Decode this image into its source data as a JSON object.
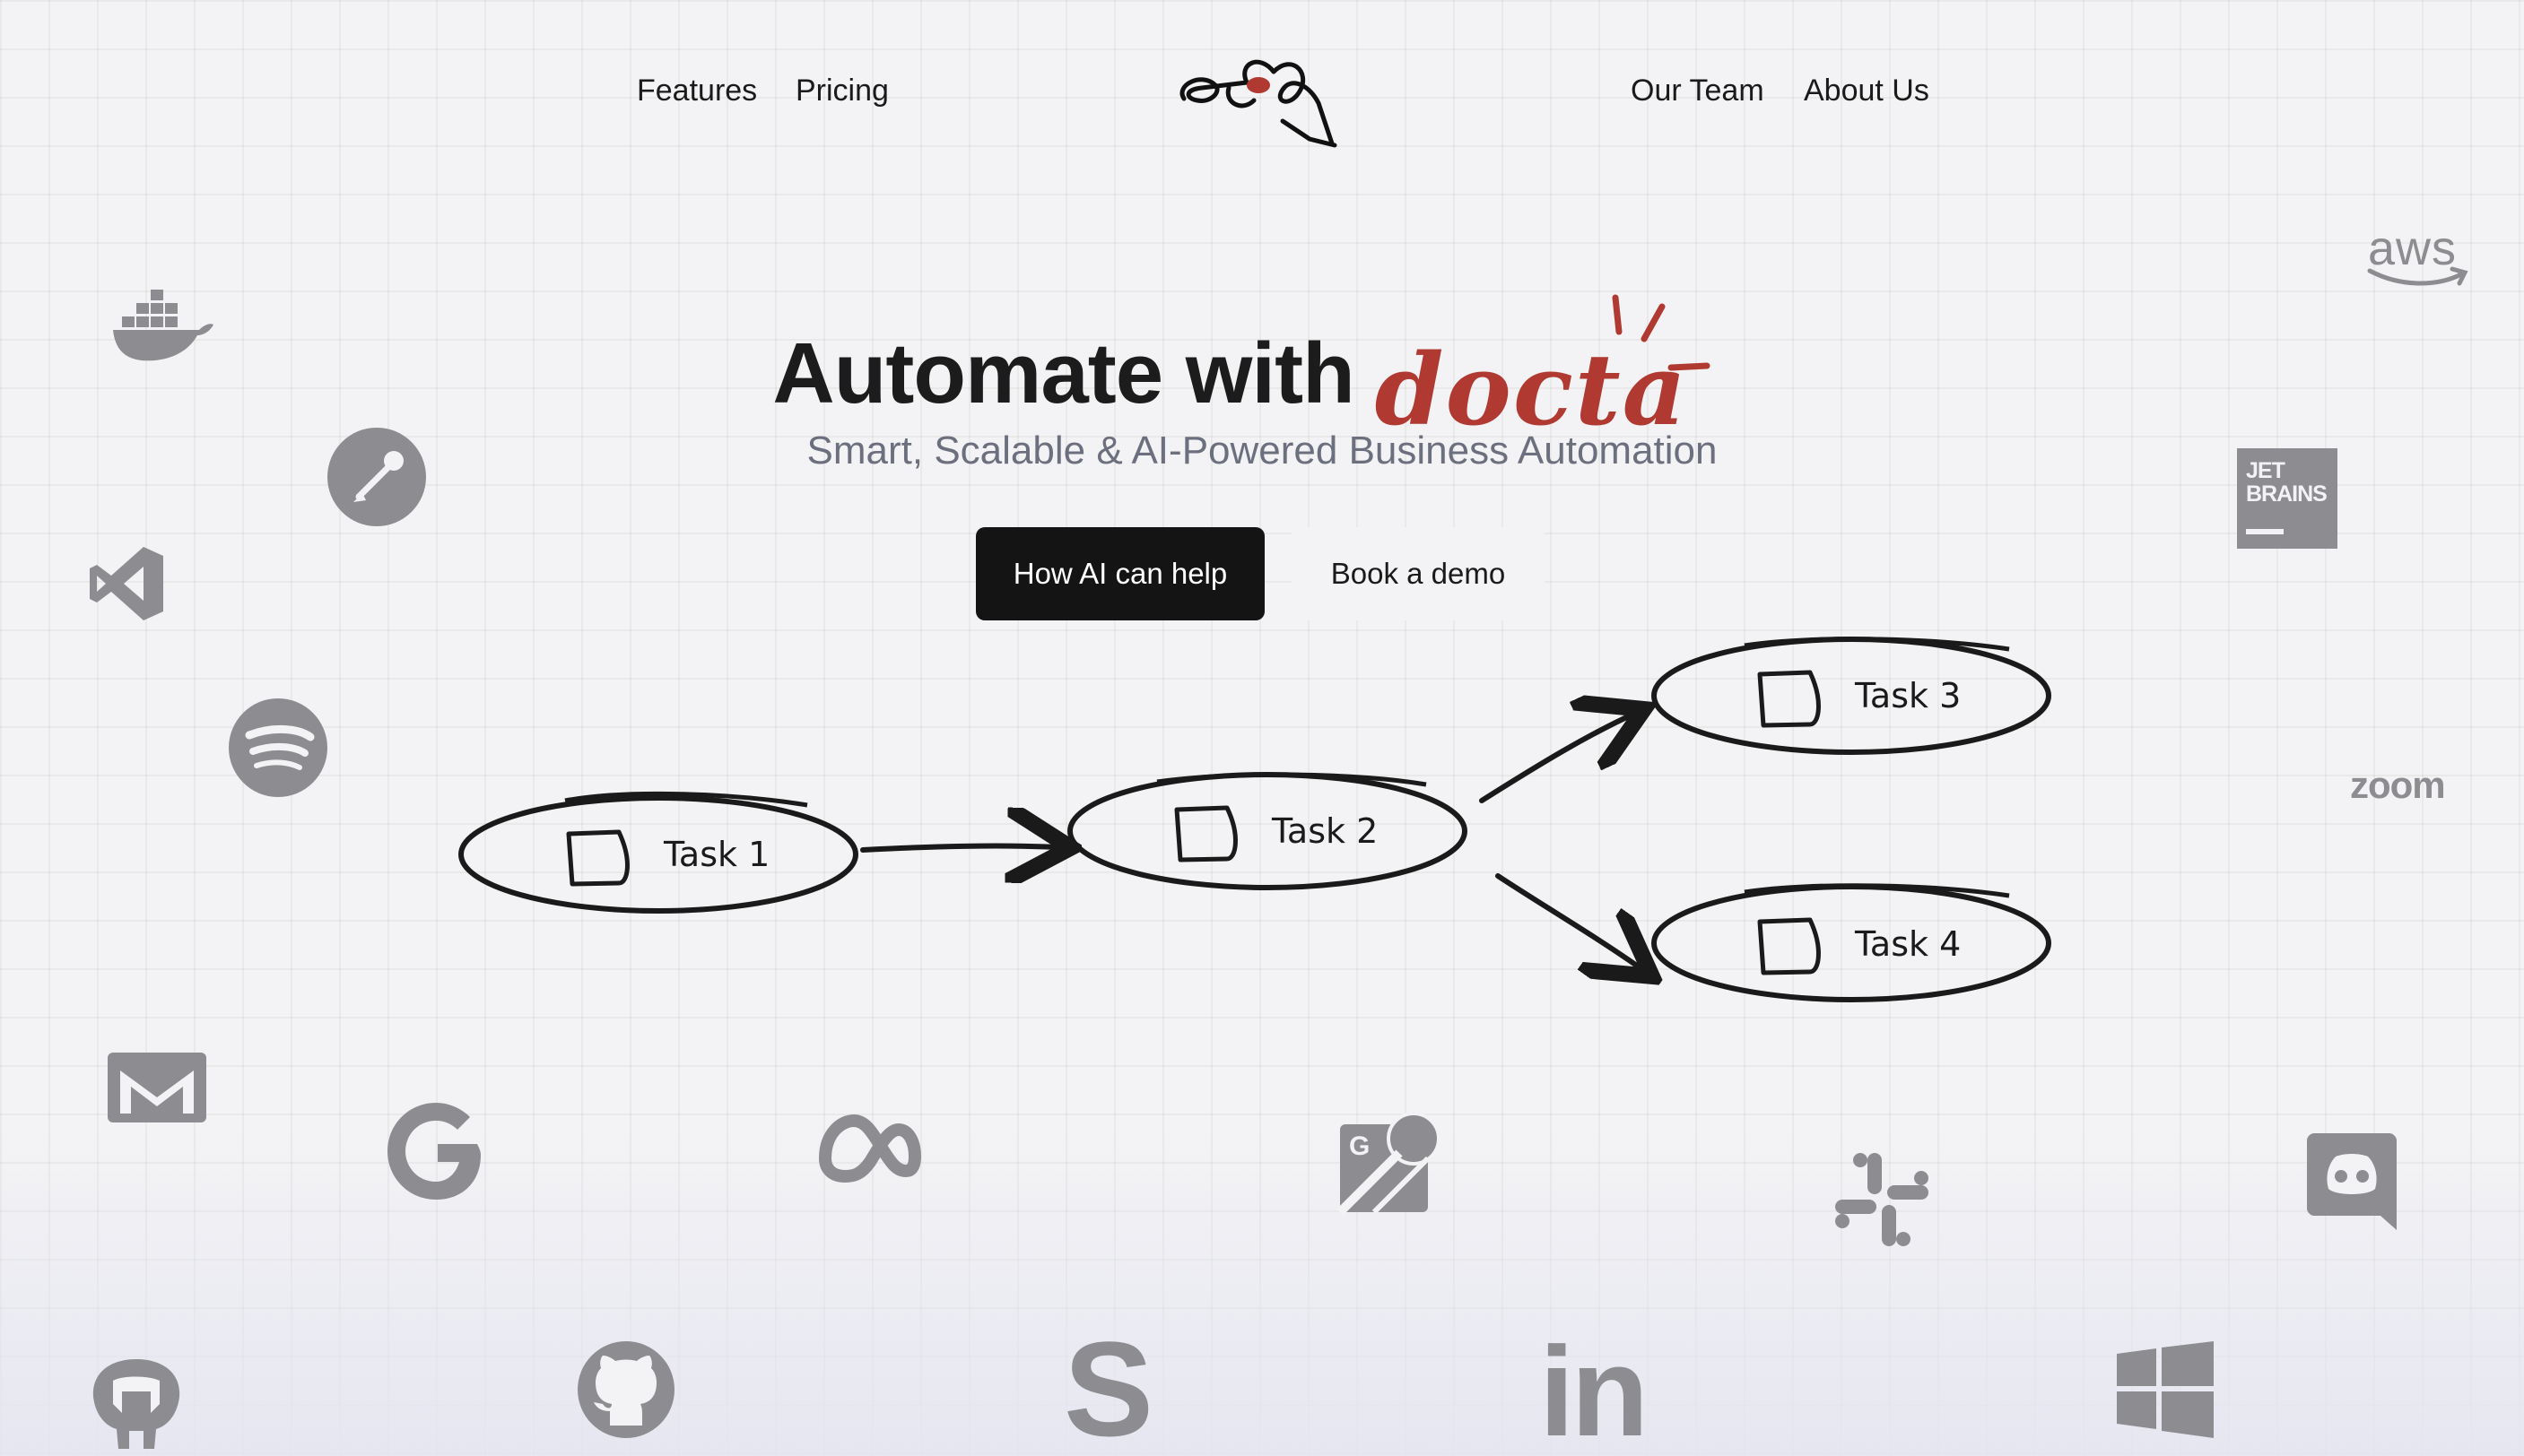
{
  "nav": {
    "left_links": [
      "Features",
      "Pricing"
    ],
    "right_links": [
      "Our Team",
      "About Us"
    ]
  },
  "hero": {
    "title_prefix": "Automate with",
    "brand": "docta",
    "subtitle": "Smart, Scalable & AI-Powered Business Automation",
    "primary_button": "How AI can help",
    "secondary_button": "Book a demo"
  },
  "flow": {
    "tasks": [
      "Task 1",
      "Task 2",
      "Task 3",
      "Task 4"
    ]
  },
  "integrations": {
    "aws_label": "aws",
    "jetbrains_label_1": "JET",
    "jetbrains_label_2": "BRAINS",
    "zoom_label": "zoom",
    "linkedin_label": "in",
    "skype_label": "S",
    "google_label": "G",
    "icons": [
      "docker-icon",
      "postman-icon",
      "visual-studio-icon",
      "spotify-icon",
      "gmail-icon",
      "google-icon",
      "meta-icon",
      "google-maps-icon",
      "slack-icon",
      "discord-icon",
      "postgresql-icon",
      "github-icon",
      "skype-icon",
      "linkedin-icon",
      "windows-icon",
      "aws-icon",
      "jetbrains-icon",
      "zoom-icon"
    ]
  },
  "colors": {
    "brand_red": "#b03a32",
    "primary_button_bg": "#141414",
    "subtitle": "#6c6f7e",
    "logo_gray": "#8d8d91"
  }
}
